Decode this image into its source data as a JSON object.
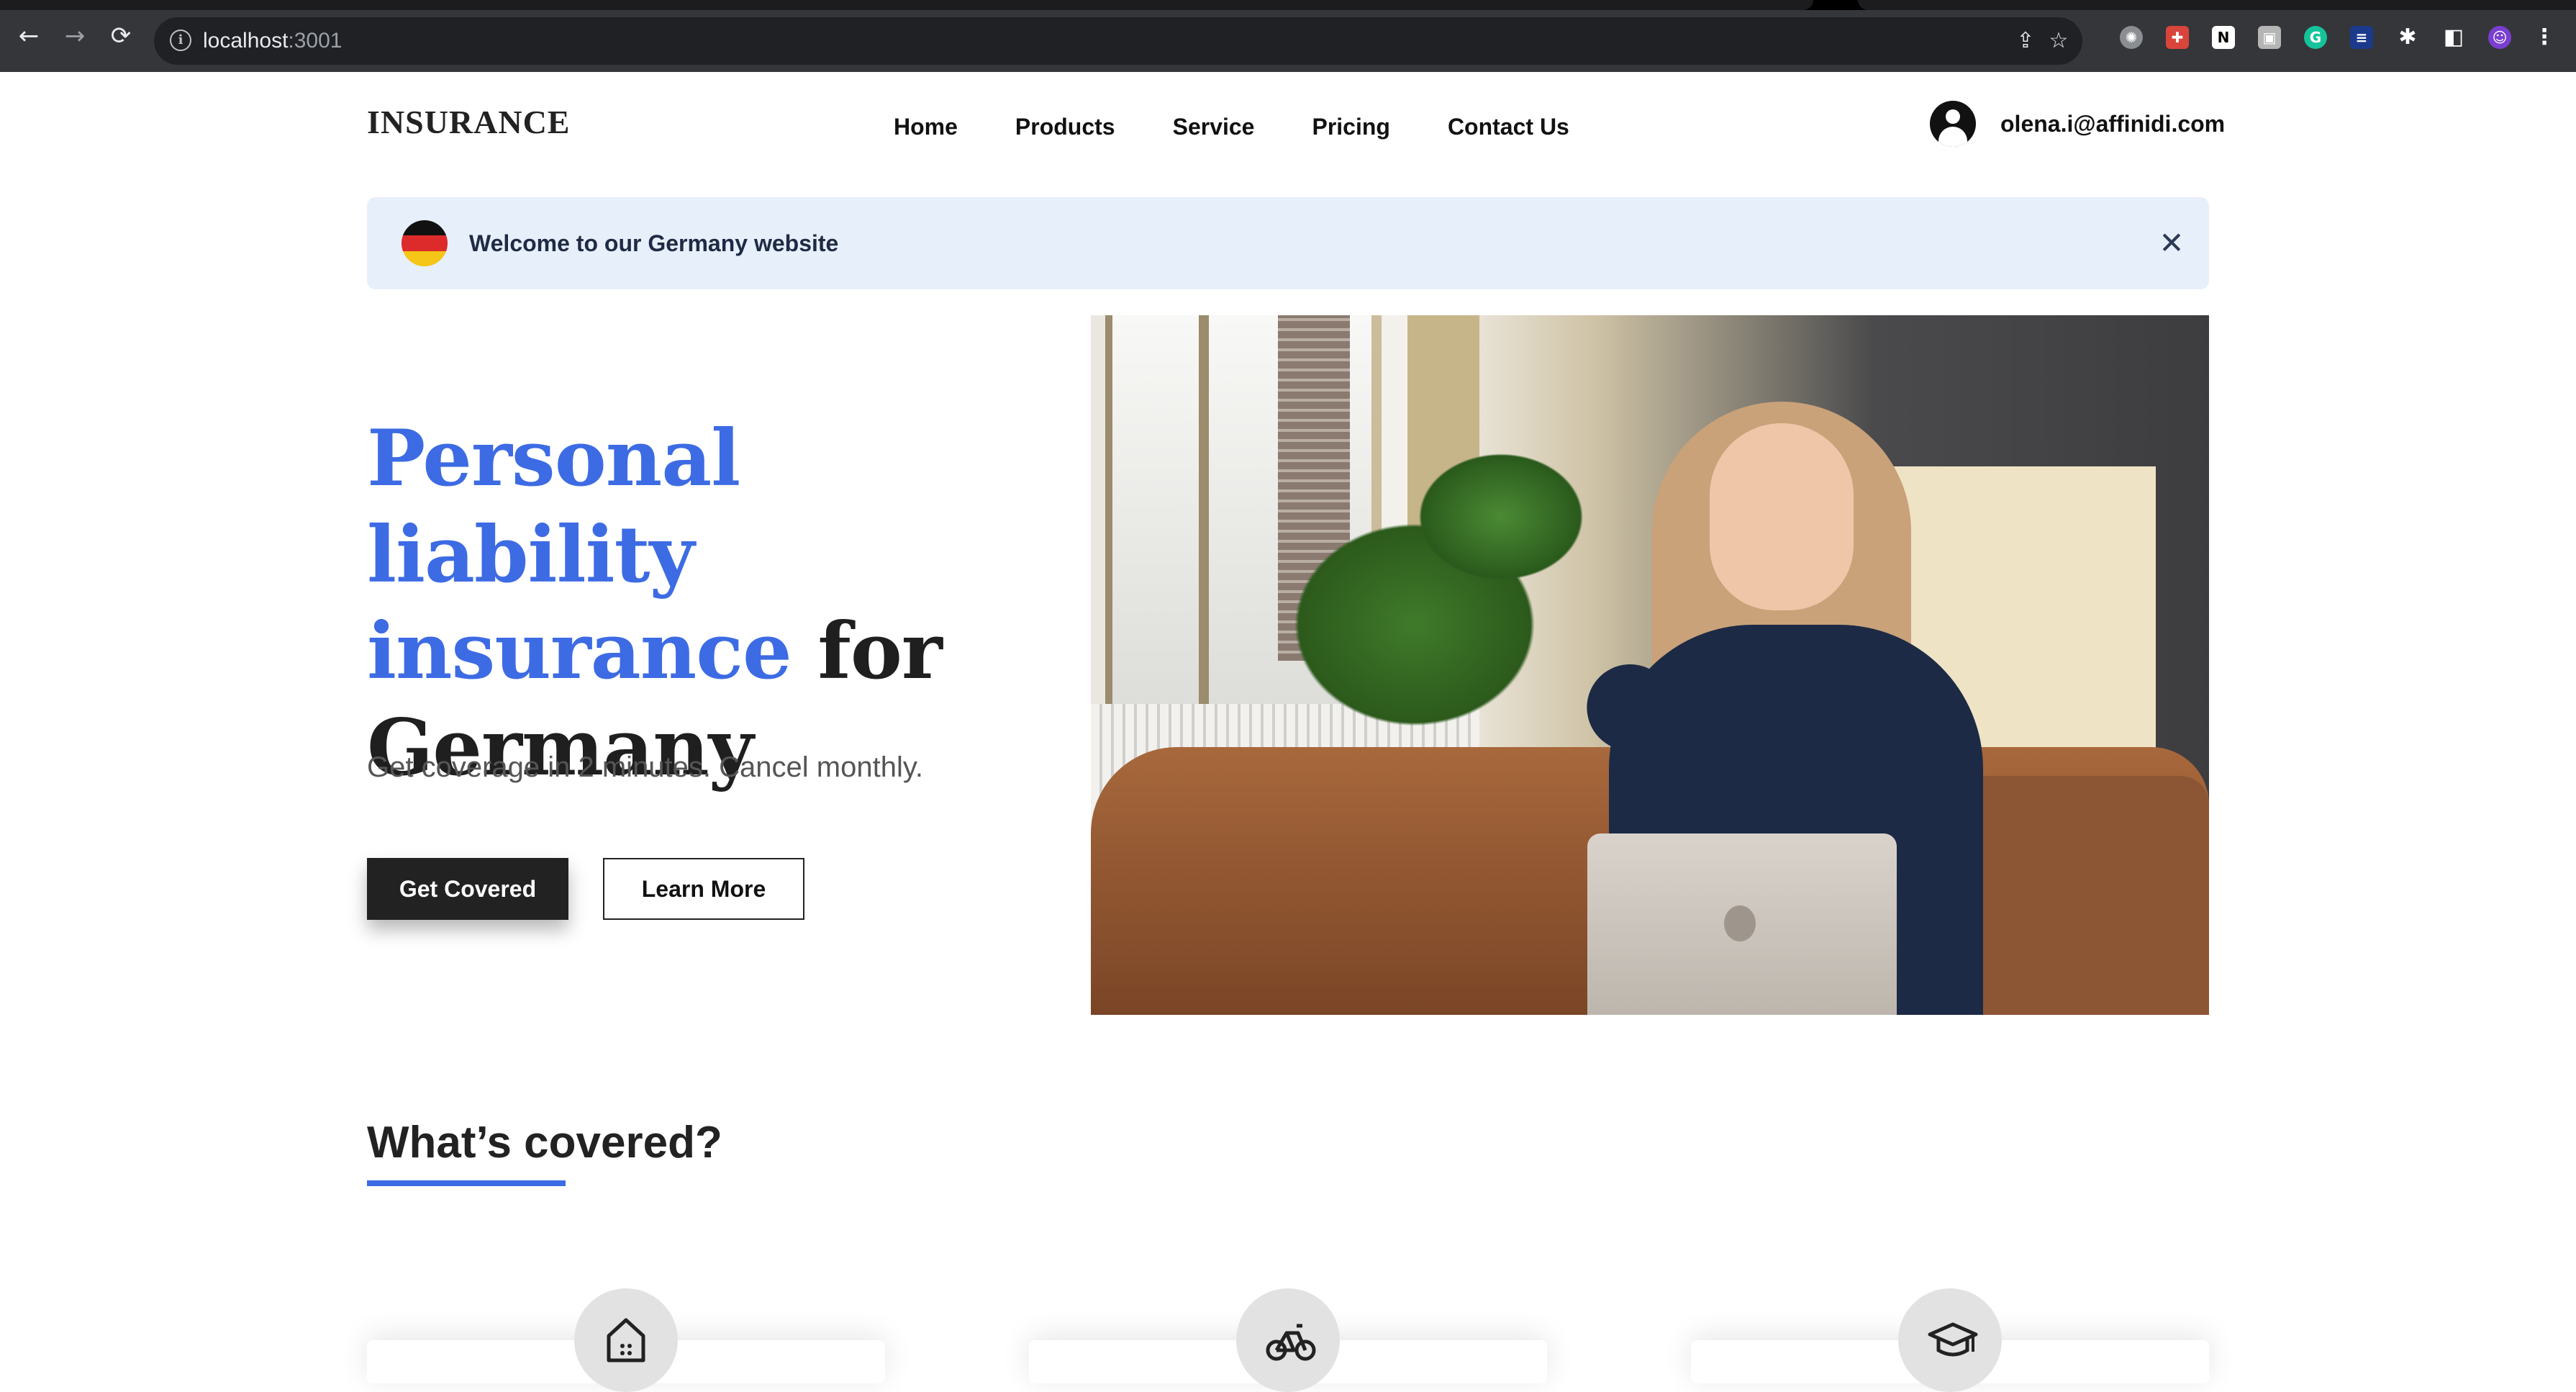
{
  "browser": {
    "url_host": "localhost",
    "url_port": ":3001",
    "icons": [
      "back-icon",
      "forward-icon",
      "reload-icon",
      "info-icon",
      "share-icon",
      "bookmark-star-icon",
      "extension-icon",
      "sidebar-icon",
      "menu-icon"
    ]
  },
  "site": {
    "logo": "INSURANCE",
    "nav": [
      "Home",
      "Products",
      "Service",
      "Pricing",
      "Contact Us"
    ],
    "user_email": "olena.i@affinidi.com"
  },
  "banner": {
    "text": "Welcome to our Germany website",
    "flag_colors": [
      "#111111",
      "#dd2a2a",
      "#f5c518"
    ]
  },
  "hero": {
    "title_accent": "Personal liability insurance",
    "title_rest_1": "for",
    "title_rest_2": "Germany",
    "subtitle": "Get coverage in 2 minutes. Cancel monthly.",
    "primary_cta": "Get Covered",
    "secondary_cta": "Learn More",
    "image_alt": "woman on sofa with laptop"
  },
  "covered": {
    "title": "What’s covered?",
    "items": [
      {
        "icon": "home-icon"
      },
      {
        "icon": "bicycle-icon"
      },
      {
        "icon": "graduation-cap-icon"
      }
    ]
  },
  "colors": {
    "accent": "#3d6be4",
    "banner_bg": "#e7effb",
    "dark": "#222222"
  }
}
